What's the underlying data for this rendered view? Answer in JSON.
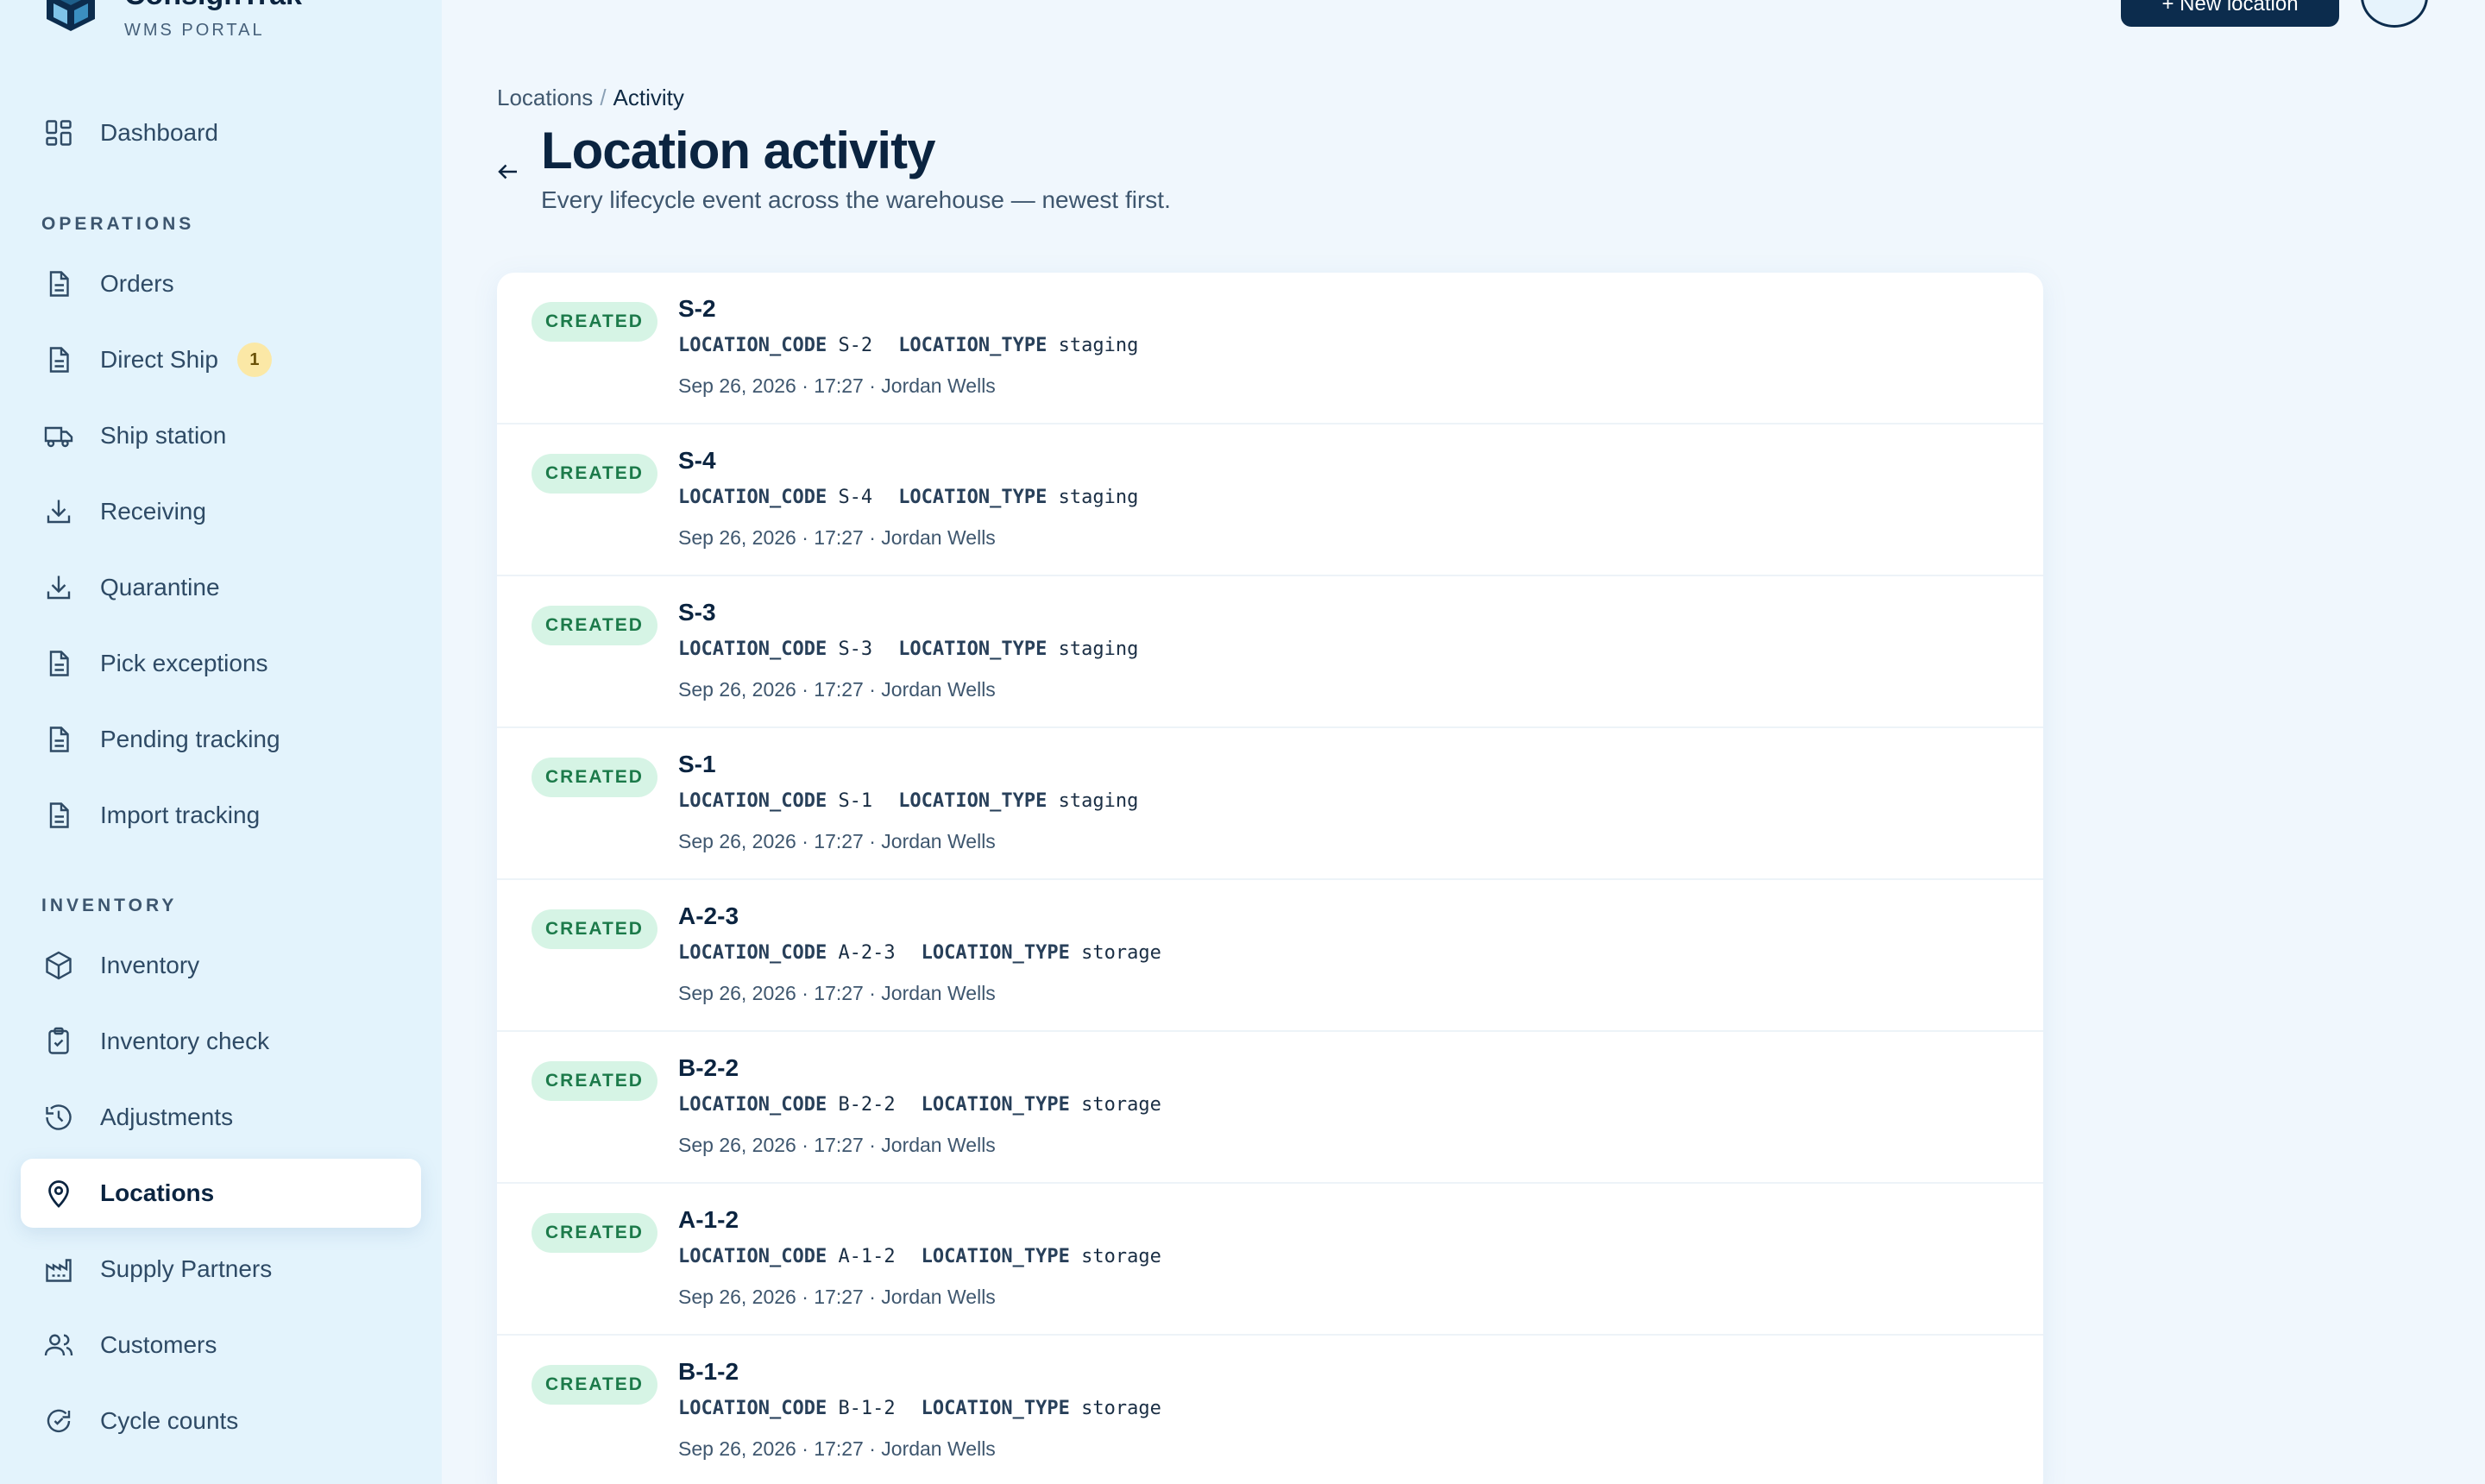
{
  "brand": {
    "name": "ConsignTrak",
    "subtitle": "WMS PORTAL"
  },
  "header": {
    "top_button_label": "+ New location",
    "breadcrumb": {
      "parent": "Locations",
      "separator": "/",
      "current": "Activity"
    },
    "title": "Location activity",
    "subtitle": "Every lifecycle event across the warehouse — newest first."
  },
  "sidebar": {
    "dashboard": {
      "label": "Dashboard",
      "icon": "dashboard-icon"
    },
    "operations_title": "OPERATIONS",
    "operations": [
      {
        "label": "Orders",
        "icon": "document-icon"
      },
      {
        "label": "Direct Ship",
        "icon": "document-icon",
        "badge": "1"
      },
      {
        "label": "Ship station",
        "icon": "truck-icon"
      },
      {
        "label": "Receiving",
        "icon": "download-icon"
      },
      {
        "label": "Quarantine",
        "icon": "download-icon"
      },
      {
        "label": "Pick exceptions",
        "icon": "document-icon"
      },
      {
        "label": "Pending tracking",
        "icon": "document-icon"
      },
      {
        "label": "Import tracking",
        "icon": "document-icon"
      }
    ],
    "inventory_title": "INVENTORY",
    "inventory": [
      {
        "label": "Inventory",
        "icon": "box-icon"
      },
      {
        "label": "Inventory check",
        "icon": "clipboard-check-icon"
      },
      {
        "label": "Adjustments",
        "icon": "history-icon"
      },
      {
        "label": "Locations",
        "icon": "map-pin-icon",
        "active": true
      },
      {
        "label": "Supply Partners",
        "icon": "factory-icon"
      },
      {
        "label": "Customers",
        "icon": "users-icon"
      },
      {
        "label": "Cycle counts",
        "icon": "refresh-icon"
      }
    ]
  },
  "activity": {
    "items": [
      {
        "event": "CREATED",
        "title": "S-2",
        "code_key": "LOCATION_CODE",
        "code_value": "S-2",
        "type_key": "LOCATION_TYPE",
        "type_value": "staging",
        "timestamp": "Sep 26, 2026 · 17:27 · Jordan Wells"
      },
      {
        "event": "CREATED",
        "title": "S-4",
        "code_key": "LOCATION_CODE",
        "code_value": "S-4",
        "type_key": "LOCATION_TYPE",
        "type_value": "staging",
        "timestamp": "Sep 26, 2026 · 17:27 · Jordan Wells"
      },
      {
        "event": "CREATED",
        "title": "S-3",
        "code_key": "LOCATION_CODE",
        "code_value": "S-3",
        "type_key": "LOCATION_TYPE",
        "type_value": "staging",
        "timestamp": "Sep 26, 2026 · 17:27 · Jordan Wells"
      },
      {
        "event": "CREATED",
        "title": "S-1",
        "code_key": "LOCATION_CODE",
        "code_value": "S-1",
        "type_key": "LOCATION_TYPE",
        "type_value": "staging",
        "timestamp": "Sep 26, 2026 · 17:27 · Jordan Wells"
      },
      {
        "event": "CREATED",
        "title": "A-2-3",
        "code_key": "LOCATION_CODE",
        "code_value": "A-2-3",
        "type_key": "LOCATION_TYPE",
        "type_value": "storage",
        "timestamp": "Sep 26, 2026 · 17:27 · Jordan Wells"
      },
      {
        "event": "CREATED",
        "title": "B-2-2",
        "code_key": "LOCATION_CODE",
        "code_value": "B-2-2",
        "type_key": "LOCATION_TYPE",
        "type_value": "storage",
        "timestamp": "Sep 26, 2026 · 17:27 · Jordan Wells"
      },
      {
        "event": "CREATED",
        "title": "A-1-2",
        "code_key": "LOCATION_CODE",
        "code_value": "A-1-2",
        "type_key": "LOCATION_TYPE",
        "type_value": "storage",
        "timestamp": "Sep 26, 2026 · 17:27 · Jordan Wells"
      },
      {
        "event": "CREATED",
        "title": "B-1-2",
        "code_key": "LOCATION_CODE",
        "code_value": "B-1-2",
        "type_key": "LOCATION_TYPE",
        "type_value": "storage",
        "timestamp": "Sep 26, 2026 · 17:27 · Jordan Wells"
      }
    ]
  },
  "colors": {
    "sidebar_bg": "#e3f3fc",
    "page_bg": "#f0f7fd",
    "primary": "#0c2c4d",
    "badge_bg": "#d6f4e5",
    "badge_text": "#1c7a4a",
    "count_badge_bg": "#fbe8a6"
  }
}
